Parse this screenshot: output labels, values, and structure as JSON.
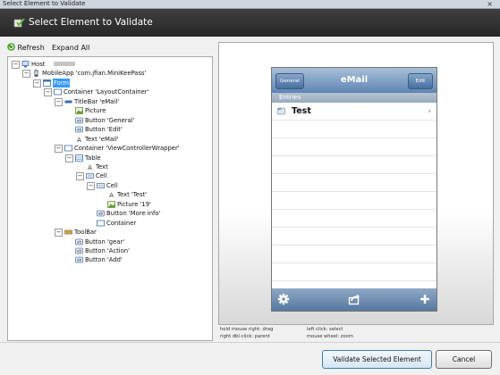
{
  "window": {
    "title": "Select Element to Validate",
    "close_glyph": "×"
  },
  "header": {
    "title": "Select Element to Validate",
    "icon": "checkmark-page-icon"
  },
  "toolbar": {
    "refresh_label": "Refresh",
    "expand_all_label": "Expand All"
  },
  "tree": {
    "nodes": [
      {
        "label": "Host",
        "icon": "host-icon",
        "expanded": true,
        "redacted": true
      },
      {
        "label": "MobileApp 'com.jfian.MiniKeePass'",
        "icon": "phone-icon",
        "expanded": true
      },
      {
        "label": "Form",
        "icon": "form-icon",
        "expanded": true,
        "selected": true
      },
      {
        "label": "Container 'LayoutContainer'",
        "icon": "container-icon",
        "expanded": true
      },
      {
        "label": "TitleBar 'eMail'",
        "icon": "titlebar-icon",
        "expanded": true
      },
      {
        "label": "Picture",
        "icon": "picture-icon"
      },
      {
        "label": "Button 'General'",
        "icon": "button-icon"
      },
      {
        "label": "Button 'Edit'",
        "icon": "button-icon"
      },
      {
        "label": "Text 'eMail'",
        "icon": "text-icon"
      },
      {
        "label": "Container 'ViewControllerWrapper'",
        "icon": "container-icon",
        "expanded": true
      },
      {
        "label": "Table",
        "icon": "table-icon",
        "expanded": true
      },
      {
        "label": "Text",
        "icon": "text-icon"
      },
      {
        "label": "Cell",
        "icon": "cell-icon",
        "expanded": true
      },
      {
        "label": "Cell",
        "icon": "cell-icon",
        "expanded": true
      },
      {
        "label": "Text 'Test'",
        "icon": "text-icon"
      },
      {
        "label": "Picture '19'",
        "icon": "picture-icon"
      },
      {
        "label": "Button 'More info'",
        "icon": "button-icon"
      },
      {
        "label": "Container",
        "icon": "container-icon"
      },
      {
        "label": "ToolBar",
        "icon": "toolbar-icon",
        "expanded": true
      },
      {
        "label": "Button 'gear'",
        "icon": "button-icon"
      },
      {
        "label": "Button 'Action'",
        "icon": "button-icon"
      },
      {
        "label": "Button 'Add'",
        "icon": "button-icon"
      }
    ]
  },
  "preview": {
    "nav_left_button": "General",
    "nav_title": "eMail",
    "nav_right_button": "Edit",
    "section_header": "Entries",
    "rows": [
      {
        "label": "Test",
        "icon": "folder-icon",
        "accessory": "›"
      }
    ],
    "tabbar_icons": [
      "gear-icon",
      "action-icon",
      "add-icon"
    ]
  },
  "hints": {
    "hold_right": "hold mouse right: drag",
    "right_dbl": "right dbl-click: parent",
    "left_click": "left click: select",
    "mouse_wheel": "mouse wheel: zoom"
  },
  "buttons": {
    "validate_label": "Validate Selected Element",
    "cancel_label": "Cancel"
  }
}
